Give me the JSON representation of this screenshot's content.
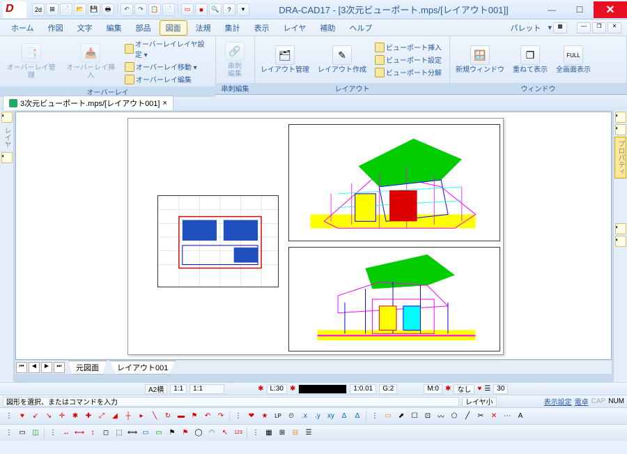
{
  "title": "DRA-CAD17 - [3次元ビューポート.mps/[レイアウト001]]",
  "menu": [
    "ホーム",
    "作図",
    "文字",
    "編集",
    "部品",
    "図面",
    "法規",
    "集計",
    "表示",
    "レイヤ",
    "補助",
    "ヘルプ"
  ],
  "menu_active_index": 5,
  "pallet_label": "パレット",
  "ribbon": {
    "group1": {
      "label": "オーバーレイ",
      "btn1": "オーバーレイ管理",
      "btn2": "オーバーレイ挿入",
      "small1": "オーバーレイレイヤ設定 ▾",
      "small2": "オーバーレイ移動 ▾",
      "small3": "オーバーレイ編集"
    },
    "group2": {
      "label": "串刺編集",
      "btn1": "串刺\n編集"
    },
    "group3": {
      "label": "レイアウト",
      "btn1": "レイアウト管理",
      "btn2": "レイアウト作成",
      "s1": "ビューポート挿入",
      "s2": "ビューポート設定",
      "s3": "ビューポート分解"
    },
    "group4": {
      "label": "ウィンドウ",
      "btn1": "新規ウィンドウ",
      "btn2": "重ねて表示",
      "btn3": "全画面表示"
    }
  },
  "doc_tab": "3次元ビューポート.mps/[レイアウト001]",
  "side_left_label": "レイヤ",
  "side_right_label": "プロパティ",
  "sheets": {
    "s1": "元図面",
    "s2": "レイアウト001"
  },
  "status": {
    "paper": "A2横",
    "r1": "1:1",
    "r2": "1:1",
    "l": "L:30",
    "coord": "1:0.01",
    "g": "G:2",
    "m": "M:0",
    "none": "なし",
    "num": "30",
    "prompt": "図形を選択、またはコマンドを入力",
    "layer_small": "レイヤ小",
    "disp": "表示設定",
    "calc": "電卓",
    "cap": "CAP",
    "numlock": "NUM"
  }
}
